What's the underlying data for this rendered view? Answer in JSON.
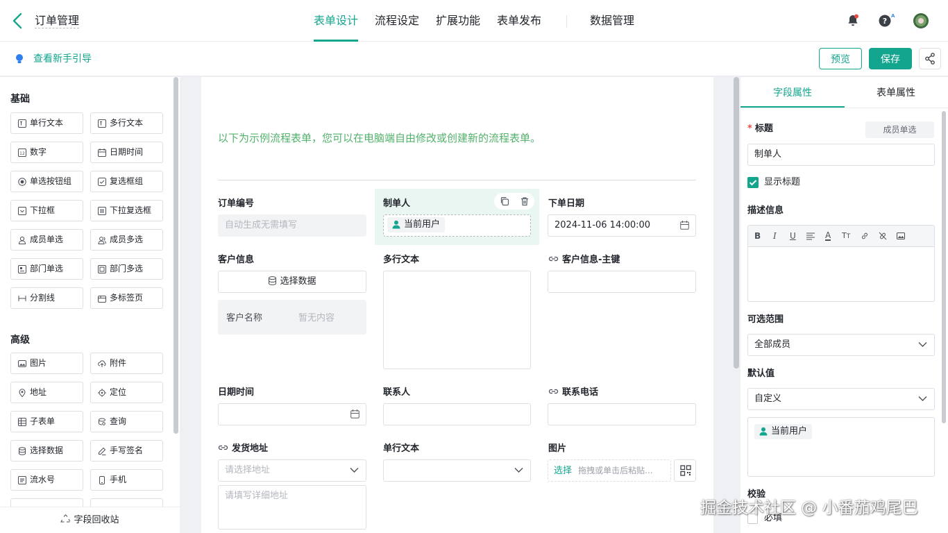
{
  "header": {
    "back_icon": "chevron-left-icon",
    "title": "订单管理",
    "tabs": [
      "表单设计",
      "流程设定",
      "扩展功能",
      "表单发布",
      "数据管理"
    ],
    "active_tab": "表单设计",
    "icons": [
      "bell-icon",
      "help-ai-icon",
      "avatar"
    ],
    "accent": "#14a58f"
  },
  "subbar": {
    "guide_label": "查看新手引导",
    "preview_label": "预览",
    "save_label": "保存",
    "share_icon": "share-icon"
  },
  "left": {
    "basic_title": "基础",
    "basic": [
      "单行文本",
      "多行文本",
      "数字",
      "日期时间",
      "单选按钮组",
      "复选框组",
      "下拉框",
      "下拉复选框",
      "成员单选",
      "成员多选",
      "部门单选",
      "部门多选",
      "分割线",
      "多标签页"
    ],
    "advanced_title": "高级",
    "advanced": [
      "图片",
      "附件",
      "地址",
      "定位",
      "子表单",
      "查询",
      "选择数据",
      "手写签名",
      "流水号",
      "手机"
    ],
    "recycle_label": "字段回收站"
  },
  "canvas": {
    "intro": "以下为示例流程表单，您可以在电脑端自由修改或创建新的流程表单。",
    "order_no": {
      "label": "订单编号",
      "placeholder": "自动生成无需填写"
    },
    "creator": {
      "label": "制单人",
      "value": "当前用户"
    },
    "order_date": {
      "label": "下单日期",
      "value": "2024-11-06 14:00:00"
    },
    "customer": {
      "label": "客户信息",
      "button": "选择数据",
      "sub_label": "客户名称",
      "sub_value": "暂无内容"
    },
    "multiline": {
      "label": "多行文本"
    },
    "customer_key": {
      "label": "客户信息-主键"
    },
    "datetime": {
      "label": "日期时间"
    },
    "contact": {
      "label": "联系人"
    },
    "phone": {
      "label": "联系电话"
    },
    "address": {
      "label": "发货地址",
      "placeholder": "请选择地址",
      "detail_placeholder": "请填写详细地址"
    },
    "single": {
      "label": "单行文本"
    },
    "image": {
      "label": "图片",
      "select": "选择",
      "hint": "拖拽或单击后粘贴..."
    }
  },
  "right": {
    "tabs": [
      "字段属性",
      "表单属性"
    ],
    "title_label": "标题",
    "type_badge": "成员单选",
    "title_value": "制单人",
    "show_title": "显示标题",
    "desc_label": "描述信息",
    "range_label": "可选范围",
    "range_value": "全部成员",
    "default_label": "默认值",
    "default_value": "自定义",
    "default_user": "当前用户",
    "validate_label": "校验",
    "required_label": "必填"
  },
  "watermark": "掘金技术社区 @ 小番茄鸡尾巴"
}
